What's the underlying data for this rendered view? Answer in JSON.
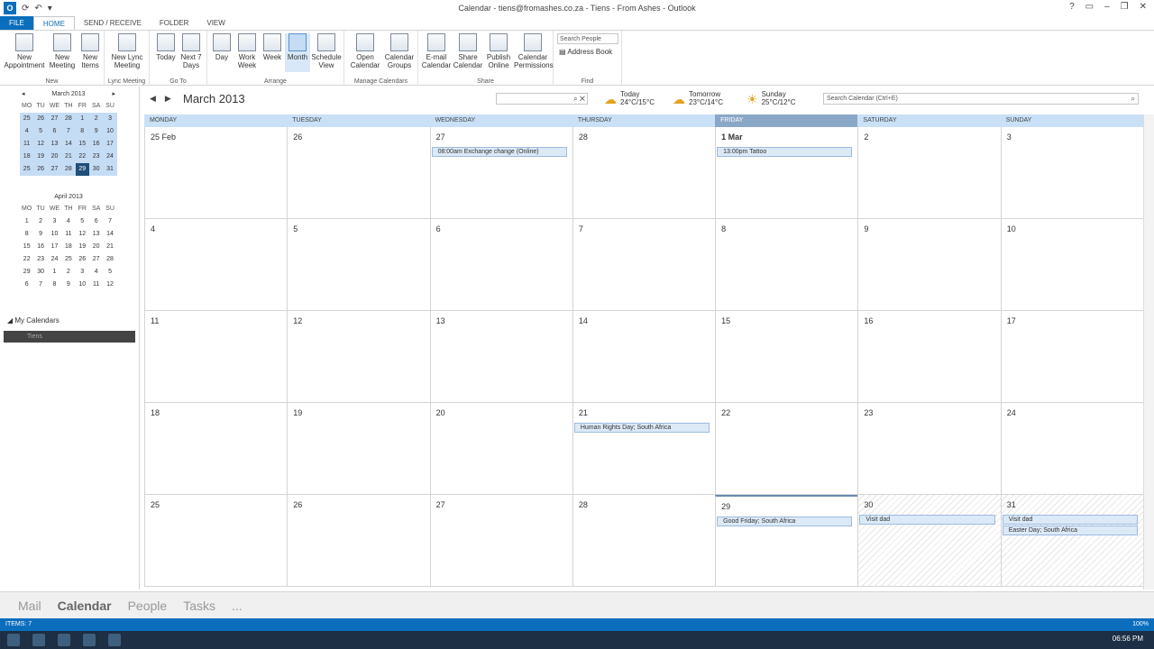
{
  "window": {
    "title": "Calendar - tiens@fromashes.co.za - Tiens - From Ashes - Outlook",
    "controls": [
      "?",
      "▭",
      "–",
      "❐",
      "✕"
    ]
  },
  "tabs": [
    {
      "label": "FILE"
    },
    {
      "label": "HOME"
    },
    {
      "label": "SEND / RECEIVE"
    },
    {
      "label": "FOLDER"
    },
    {
      "label": "VIEW"
    }
  ],
  "ribbon": {
    "groups": {
      "new": "New",
      "lync": "Lync Meeting",
      "goto": "Go To",
      "arrange": "Arrange",
      "manage": "Manage Calendars",
      "share": "Share",
      "find": "Find"
    },
    "buttons": {
      "new_appointment": "New Appointment",
      "new_meeting": "New Meeting",
      "new_items": "New Items",
      "new_lync_meeting": "New Lync Meeting",
      "today": "Today",
      "next7": "Next 7 Days",
      "day": "Day",
      "work_week": "Work Week",
      "week": "Week",
      "month": "Month",
      "schedule": "Schedule View",
      "open_calendar": "Open Calendar",
      "calendar_groups": "Calendar Groups",
      "email_calendar": "E-mail Calendar",
      "share_calendar": "Share Calendar",
      "publish_online": "Publish Online",
      "calendar_permissions": "Calendar Permissions"
    },
    "search_people": "Search People",
    "address_book": "Address Book"
  },
  "leftpane": {
    "mini1": {
      "title": "March 2013",
      "days": [
        "MO",
        "TU",
        "WE",
        "TH",
        "FR",
        "SA",
        "SU"
      ],
      "dates": [
        "25",
        "26",
        "27",
        "28",
        "1",
        "2",
        "3",
        "4",
        "5",
        "6",
        "7",
        "8",
        "9",
        "10",
        "11",
        "12",
        "13",
        "14",
        "15",
        "16",
        "17",
        "18",
        "19",
        "20",
        "21",
        "22",
        "23",
        "24",
        "25",
        "26",
        "27",
        "28",
        "29",
        "30",
        "31"
      ]
    },
    "mini2": {
      "title": "April 2013",
      "days": [
        "MO",
        "TU",
        "WE",
        "TH",
        "FR",
        "SA",
        "SU"
      ],
      "dates": [
        "1",
        "2",
        "3",
        "4",
        "5",
        "6",
        "7",
        "8",
        "9",
        "10",
        "11",
        "12",
        "13",
        "14",
        "15",
        "16",
        "17",
        "18",
        "19",
        "20",
        "21",
        "22",
        "23",
        "24",
        "25",
        "26",
        "27",
        "28",
        "29",
        "30",
        "1",
        "2",
        "3",
        "4",
        "5",
        "6",
        "7",
        "8",
        "9",
        "10",
        "11",
        "12"
      ]
    },
    "my_calendars": "My Calendars",
    "calendar_item": "Tiens"
  },
  "header": {
    "month_title": "March 2013",
    "weather": [
      {
        "label": "Today",
        "temp": "24°C/15°C",
        "icon": "sun-cloud-icon"
      },
      {
        "label": "Tomorrow",
        "temp": "23°C/14°C",
        "icon": "sun-cloud-icon"
      },
      {
        "label": "Sunday",
        "temp": "25°C/12°C",
        "icon": "sun-icon"
      }
    ],
    "search_placeholder": "Search Calendar (Ctrl+E)"
  },
  "grid": {
    "dow": [
      "MONDAY",
      "TUESDAY",
      "WEDNESDAY",
      "THURSDAY",
      "FRIDAY",
      "SATURDAY",
      "SUNDAY"
    ],
    "cells": [
      {
        "d": "25 Feb"
      },
      {
        "d": "26"
      },
      {
        "d": "27",
        "ev": [
          "08:00am Exchange change (Online)"
        ]
      },
      {
        "d": "28"
      },
      {
        "d": "1 Mar",
        "bold": true,
        "ev": [
          "13:00pm Tattoo"
        ]
      },
      {
        "d": "2"
      },
      {
        "d": "3"
      },
      {
        "d": "4"
      },
      {
        "d": "5"
      },
      {
        "d": "6"
      },
      {
        "d": "7"
      },
      {
        "d": "8"
      },
      {
        "d": "9"
      },
      {
        "d": "10"
      },
      {
        "d": "11"
      },
      {
        "d": "12"
      },
      {
        "d": "13"
      },
      {
        "d": "14"
      },
      {
        "d": "15"
      },
      {
        "d": "16"
      },
      {
        "d": "17"
      },
      {
        "d": "18"
      },
      {
        "d": "19"
      },
      {
        "d": "20"
      },
      {
        "d": "21",
        "ev": [
          "Human Rights Day; South Africa"
        ]
      },
      {
        "d": "22"
      },
      {
        "d": "23"
      },
      {
        "d": "24"
      },
      {
        "d": "25"
      },
      {
        "d": "26"
      },
      {
        "d": "27"
      },
      {
        "d": "28"
      },
      {
        "d": "29",
        "cur": true,
        "ev": [
          "Good Friday; South Africa"
        ]
      },
      {
        "d": "30",
        "hatch": true,
        "ev": [
          "Visit dad"
        ]
      },
      {
        "d": "31",
        "hatch": true,
        "ev": [
          "Visit dad",
          "Easter Day; South Africa"
        ]
      }
    ]
  },
  "navbar": [
    "Mail",
    "Calendar",
    "People",
    "Tasks",
    "..."
  ],
  "status": {
    "left": "ITEMS: 7",
    "zoom": "100%"
  },
  "clock": "06:56 PM"
}
